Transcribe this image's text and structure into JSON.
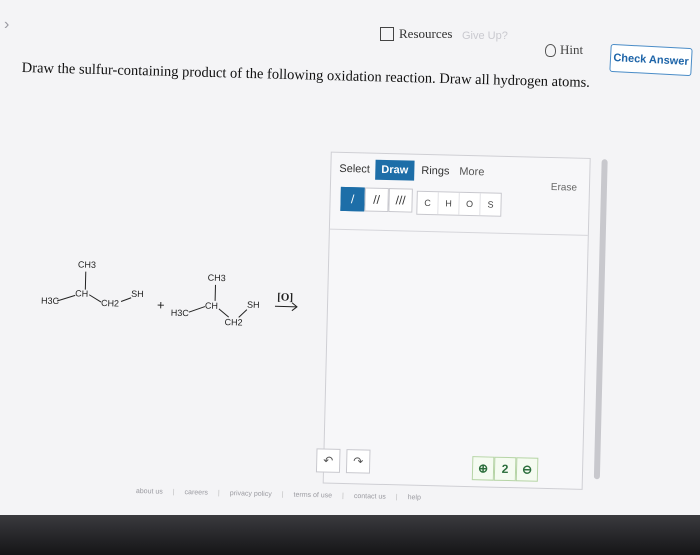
{
  "nav": {
    "back_glyph": "›"
  },
  "topbar": {
    "resources_label": "Resources",
    "giveup_label": "Give Up?",
    "hint_label": "Hint",
    "check_label": "Check Answer"
  },
  "question": {
    "text": "Draw the sulfur-containing product of the following oxidation reaction. Draw all hydrogen atoms."
  },
  "reaction": {
    "reactant1": {
      "ch3": "CH3",
      "h3c": "H3C",
      "ch": "CH",
      "ch2": "CH2",
      "sh": "SH"
    },
    "plus": "+",
    "reactant2": {
      "ch3": "CH3",
      "h3c": "H3C",
      "ch": "CH",
      "ch2": "CH2",
      "sh": "SH"
    },
    "arrow_label": "[O]"
  },
  "editor": {
    "tabs": {
      "select": "Select",
      "draw": "Draw",
      "rings": "Rings",
      "more": "More"
    },
    "erase_label": "Erase",
    "bonds": [
      "/",
      "//",
      "///"
    ],
    "atoms": [
      "C",
      "H",
      "O",
      "S"
    ],
    "undo_glyph": "↶",
    "redo_glyph": "↷",
    "zoom": [
      "⊕",
      "2",
      "⊖"
    ]
  },
  "footer": {
    "links": [
      "about us",
      "careers",
      "privacy policy",
      "terms of use",
      "contact us",
      "help"
    ]
  }
}
